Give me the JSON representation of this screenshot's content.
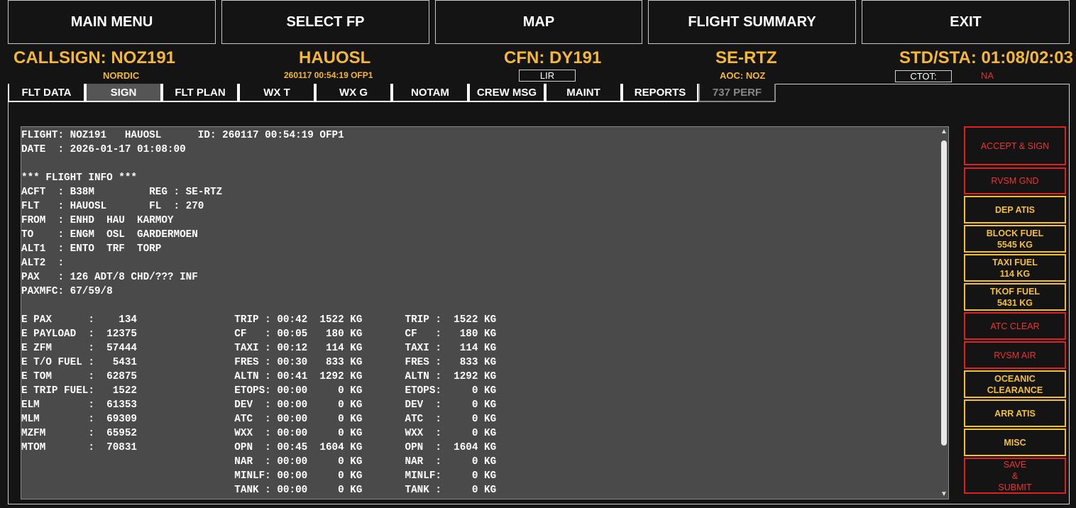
{
  "nav": [
    "MAIN MENU",
    "SELECT FP",
    "MAP",
    "FLIGHT SUMMARY",
    "EXIT"
  ],
  "header": {
    "callsign": "CALLSIGN: NOZ191",
    "airline": "NORDIC",
    "route": "HAUOSL",
    "ofp_id": "260117 00:54:19 OFP1",
    "cfn": "CFN: DY191",
    "cfn_box": "LIR",
    "reg": "SE-RTZ",
    "aoc": "AOC: NOZ",
    "std_sta": "STD/STA: 01:08/02:03",
    "ctot_label": "CTOT:",
    "ctot_value": "NA"
  },
  "tabs": [
    "FLT DATA",
    "SIGN",
    "FLT PLAN",
    "WX T",
    "WX G",
    "NOTAM",
    "CREW MSG",
    "MAINT",
    "REPORTS",
    "737 PERF"
  ],
  "active_tab": "SIGN",
  "flight_text": "FLIGHT: NOZ191   HAUOSL      ID: 260117 00:54:19 OFP1\nDATE  : 2026-01-17 01:08:00\n\n*** FLIGHT INFO ***\nACFT  : B38M         REG : SE-RTZ\nFLT   : HAUOSL       FL  : 270\nFROM  : ENHD  HAU  KARMOY\nTO    : ENGM  OSL  GARDERMOEN\nALT1  : ENTO  TRF  TORP\nALT2  :\nPAX   : 126 ADT/8 CHD/??? INF\nPAXMFC: 67/59/8\n\nE PAX      :    134                TRIP : 00:42  1522 KG       TRIP :  1522 KG\nE PAYLOAD  :  12375                CF   : 00:05   180 KG       CF   :   180 KG\nE ZFM      :  57444                TAXI : 00:12   114 KG       TAXI :   114 KG\nE T/O FUEL :   5431                FRES : 00:30   833 KG       FRES :   833 KG\nE TOM      :  62875                ALTN : 00:41  1292 KG       ALTN :  1292 KG\nE TRIP FUEL:   1522                ETOPS: 00:00     0 KG       ETOPS:     0 KG\nELM        :  61353                DEV  : 00:00     0 KG       DEV  :     0 KG\nMLM        :  69309                ATC  : 00:00     0 KG       ATC  :     0 KG\nMZFM       :  65952                WXX  : 00:00     0 KG       WXX  :     0 KG\nMTOM       :  70831                OPN  : 00:45  1604 KG       OPN  :  1604 KG\n                                   NAR  : 00:00     0 KG       NAR  :     0 KG\n                                   MINLF: 00:00     0 KG       MINLF:     0 KG\n                                   TANK : 00:00     0 KG       TANK :     0 KG",
  "side_buttons": [
    {
      "label": "ACCEPT & SIGN",
      "color": "red"
    },
    {
      "label": "RVSM GND",
      "color": "red"
    },
    {
      "label": "DEP ATIS",
      "color": "yellow"
    },
    {
      "label": "BLOCK FUEL\n5545 KG",
      "color": "yellow"
    },
    {
      "label": "TAXI FUEL\n114 KG",
      "color": "yellow"
    },
    {
      "label": "TKOF FUEL\n5431 KG",
      "color": "yellow"
    },
    {
      "label": "ATC CLEAR",
      "color": "red"
    },
    {
      "label": "RVSM AIR",
      "color": "red"
    },
    {
      "label": "OCEANIC\nCLEARANCE",
      "color": "yellow"
    },
    {
      "label": "ARR ATIS",
      "color": "yellow"
    },
    {
      "label": "MISC",
      "color": "yellow"
    },
    {
      "label": "SAVE\n&\nSUBMIT",
      "color": "red"
    }
  ]
}
